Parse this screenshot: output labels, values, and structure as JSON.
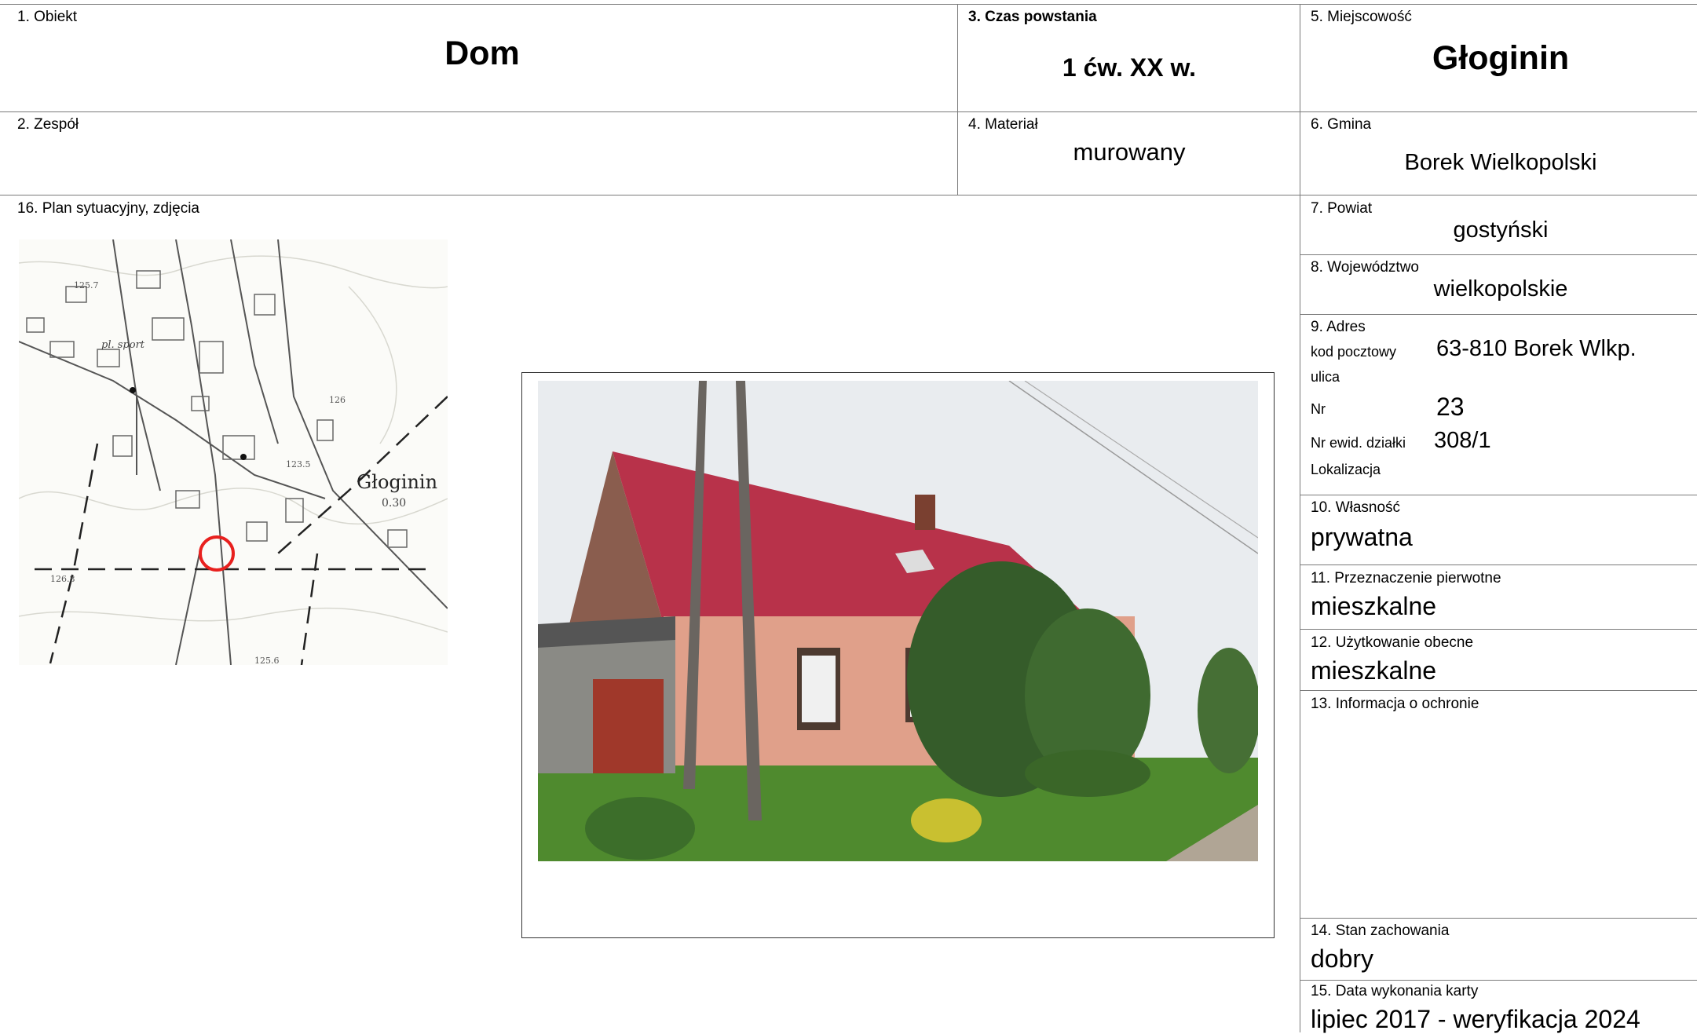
{
  "fields": {
    "obiekt": {
      "label": "1. Obiekt",
      "value": "Dom"
    },
    "zespol": {
      "label": "2. Zespół",
      "value": ""
    },
    "czas": {
      "label": "3. Czas powstania",
      "value": "1 ćw. XX w."
    },
    "material": {
      "label": "4. Materiał",
      "value": "murowany"
    },
    "miejscowosc": {
      "label": "5. Miejscowość",
      "value": "Głoginin"
    },
    "gmina": {
      "label": "6. Gmina",
      "value": "Borek Wielkopolski"
    },
    "powiat": {
      "label": "7. Powiat",
      "value": "gostyński"
    },
    "wojewodztwo": {
      "label": "8. Województwo",
      "value": "wielkopolskie"
    },
    "adres": {
      "label": "9. Adres",
      "kod_label": "kod pocztowy",
      "kod_value": "63-810 Borek Wlkp.",
      "ulica_label": "ulica",
      "nr_label": "Nr",
      "nr_value": "23",
      "dzialka_label": "Nr ewid. działki",
      "dzialka_value": "308/1",
      "lokalizacja_label": "Lokalizacja"
    },
    "wlasnosc": {
      "label": "10. Własność",
      "value": "prywatna"
    },
    "przeznaczenie": {
      "label": "11. Przeznaczenie pierwotne",
      "value": "mieszkalne"
    },
    "uzytkowanie": {
      "label": "12. Użytkowanie obecne",
      "value": "mieszkalne"
    },
    "ochrona": {
      "label": "13. Informacja o ochronie",
      "value": ""
    },
    "stan": {
      "label": "14. Stan zachowania",
      "value": "dobry"
    },
    "data": {
      "label": "15. Data wykonania karty",
      "value": "lipiec 2017 - weryfikacja 2024"
    },
    "plan": {
      "label": "16. Plan sytuacyjny, zdjęcia"
    }
  },
  "map": {
    "place_name": "Głoginin",
    "place_sub": "0.30",
    "label_sport": "pl. sport",
    "elev_1": "125.7",
    "elev_2": "126",
    "elev_3": "126.8",
    "elev_4": "125.6",
    "elev_5": "123.5",
    "marker_color": "#e8201e"
  },
  "photo": {
    "roof_color": "#b8324a",
    "wall_color": "#e0a08a"
  }
}
